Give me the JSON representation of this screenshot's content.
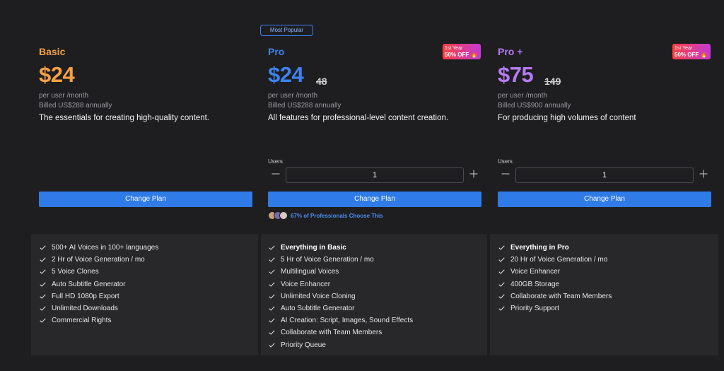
{
  "popular_tag": "Most Popular",
  "plans": {
    "basic": {
      "name": "Basic",
      "name_color": "#f5a142",
      "price": "$24",
      "per_user": "per user /month",
      "billed": "Billed US$288 annually",
      "description": "The essentials for creating high-quality content.",
      "cta": "Change Plan"
    },
    "pro": {
      "name": "Pro",
      "name_color": "#3d82ee",
      "price": "$24",
      "old_price": "48",
      "per_user": "per user /month",
      "billed": "Billed US$288 annually",
      "description": "All features for professional-level content creation.",
      "badge_line1": "1st Year",
      "badge_line2": "50% OFF 🔥",
      "users_label": "Users",
      "users_value": "1",
      "cta": "Change Plan",
      "social_text": "67% of Professionals Choose This"
    },
    "proplus": {
      "name": "Pro +",
      "name_color": "#b57bf0",
      "price": "$75",
      "old_price": "149",
      "per_user": "per user /month",
      "billed": "Billed US$900 annually",
      "description": "For producing high volumes of content",
      "badge_line1": "1st Year",
      "badge_line2": "50% OFF 🔥",
      "users_label": "Users",
      "users_value": "1",
      "cta": "Change Plan"
    }
  },
  "features": {
    "basic": [
      "500+ AI Voices in 100+ languages",
      "2 Hr of Voice Generation / mo",
      "5 Voice Clones",
      "Auto Subtitle Generator",
      "Full HD 1080p Export",
      "Unlimited Downloads",
      "Commercial Rights"
    ],
    "pro": [
      "Everything in Basic",
      "5 Hr of Voice Generation / mo",
      "Multilingual Voices",
      "Voice Enhancer",
      "Unlimited Voice Cloning",
      "Auto Subtitle Generator",
      "AI Creation: Script, Images, Sound Effects",
      "Collaborate with Team Members",
      "Priority Queue"
    ],
    "proplus": [
      "Everything in Pro",
      "20 Hr of Voice Generation / mo",
      "Voice Enhancer",
      "400GB Storage",
      "Collaborate with Team Members",
      "Priority Support"
    ]
  },
  "colors": {
    "accent": "#2f7be8",
    "background": "#1e1e21",
    "panel": "#28282b"
  },
  "icons": {
    "check": "check-icon",
    "minus": "minus-icon",
    "plus": "plus-icon",
    "fire": "fire-icon"
  }
}
